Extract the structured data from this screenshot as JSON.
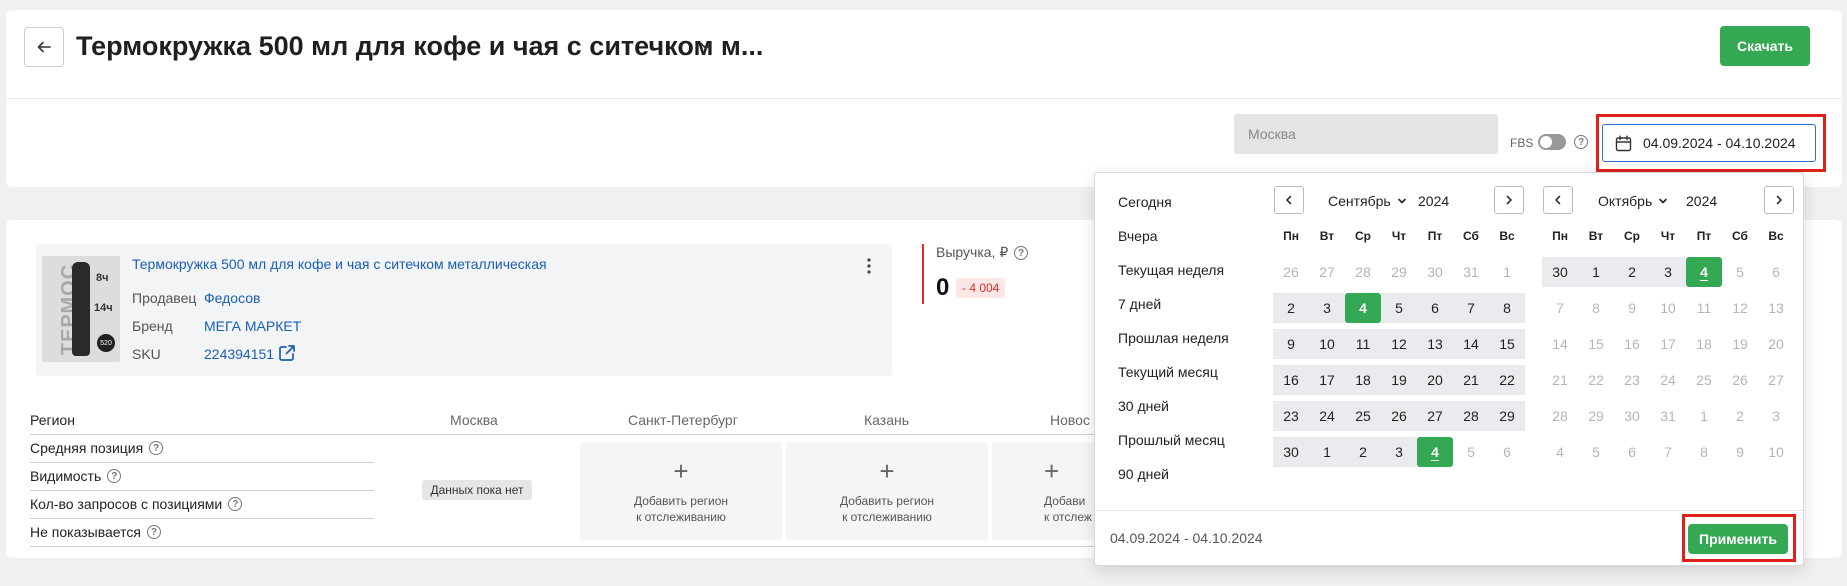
{
  "header": {
    "title": "Термокружка 500 мл для кофе и чая с ситечком м...",
    "download_label": "Скачать"
  },
  "filters": {
    "city_placeholder": "Москва",
    "fbs_label": "FBS",
    "date_range": "04.09.2024 - 04.10.2024"
  },
  "product": {
    "title": "Термокружка 500 мл для кофе и чая с ситечком металлическая",
    "seller_label": "Продавец",
    "seller": "Федосов",
    "brand_label": "Бренд",
    "brand": "МЕГА МАРКЕТ",
    "sku_label": "SKU",
    "sku": "224394151",
    "image_text": "ТЕРМОС",
    "image_badges": [
      "8ч",
      "14ч",
      "520"
    ]
  },
  "revenue": {
    "label": "Выручка, ₽",
    "value": "0",
    "delta": "- 4 004"
  },
  "table": {
    "region_header": "Регион",
    "columns": [
      "Москва",
      "Санкт-Петербург",
      "Казань",
      "Новос"
    ],
    "rows": [
      "Средняя позиция",
      "Видимость",
      "Кол-во запросов с позициями",
      "Не показывается"
    ],
    "no_data": "Данных пока нет",
    "add_region": "Добавить регион",
    "add_region_2": "к отслеживанию",
    "add_region_cut": "Добави",
    "add_region_cut_2": "к отслеж"
  },
  "calendar": {
    "presets": [
      "Сегодня",
      "Вчера",
      "Текущая неделя",
      "7 дней",
      "Прошлая неделя",
      "Текущий месяц",
      "30 дней",
      "Прошлый месяц",
      "90 дней"
    ],
    "weekdays": [
      "Пн",
      "Вт",
      "Ср",
      "Чт",
      "Пт",
      "Сб",
      "Вс"
    ],
    "left": {
      "month": "Сентябрь",
      "year": "2024",
      "weeks": [
        [
          "26",
          "27",
          "28",
          "29",
          "30",
          "31",
          "1"
        ],
        [
          "2",
          "3",
          "4",
          "5",
          "6",
          "7",
          "8"
        ],
        [
          "9",
          "10",
          "11",
          "12",
          "13",
          "14",
          "15"
        ],
        [
          "16",
          "17",
          "18",
          "19",
          "20",
          "21",
          "22"
        ],
        [
          "23",
          "24",
          "25",
          "26",
          "27",
          "28",
          "29"
        ],
        [
          "30",
          "1",
          "2",
          "3",
          "4",
          "5",
          "6"
        ]
      ]
    },
    "right": {
      "month": "Октябрь",
      "year": "2024",
      "weeks": [
        [
          "30",
          "1",
          "2",
          "3",
          "4",
          "5",
          "6"
        ],
        [
          "7",
          "8",
          "9",
          "10",
          "11",
          "12",
          "13"
        ],
        [
          "14",
          "15",
          "16",
          "17",
          "18",
          "19",
          "20"
        ],
        [
          "21",
          "22",
          "23",
          "24",
          "25",
          "26",
          "27"
        ],
        [
          "28",
          "29",
          "30",
          "31",
          "1",
          "2",
          "3"
        ],
        [
          "4",
          "5",
          "6",
          "7",
          "8",
          "9",
          "10"
        ]
      ]
    },
    "footer_range": "04.09.2024 - 04.10.2024",
    "apply_label": "Применить"
  },
  "colors": {
    "accent_green": "#34a853",
    "highlight_red": "#e0201b",
    "link_blue": "#1a5fb4"
  }
}
